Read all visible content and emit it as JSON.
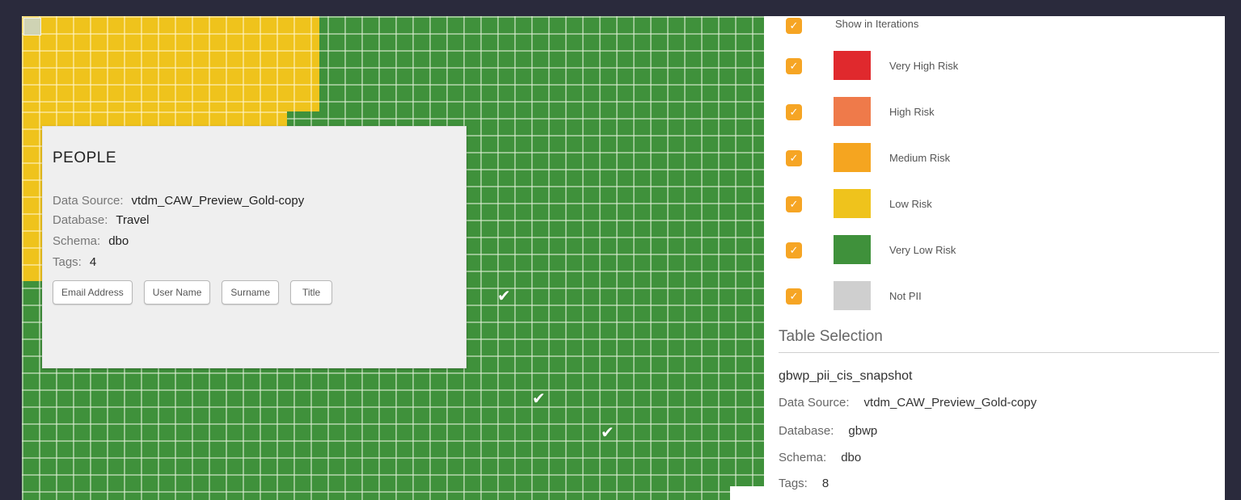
{
  "colors": {
    "very_high": "#e0292d",
    "high": "#ef7a4a",
    "medium": "#f5a520",
    "low": "#efc31c",
    "very_low": "#3f913b",
    "not_pii": "#cfcfcf",
    "checkbox": "#f6a524"
  },
  "popup": {
    "title": "PEOPLE",
    "data_source_label": "Data Source:",
    "data_source_value": "vtdm_CAW_Preview_Gold-copy",
    "database_label": "Database:",
    "database_value": "Travel",
    "schema_label": "Schema:",
    "schema_value": "dbo",
    "tags_label": "Tags:",
    "tags_count": "4",
    "tags": [
      "Email Address",
      "User Name",
      "Surname",
      "Title"
    ]
  },
  "legend": {
    "header": "Show in Iterations",
    "items": [
      {
        "label": "Very High Risk",
        "checked": true,
        "color": "#e0292d"
      },
      {
        "label": "High Risk",
        "checked": true,
        "color": "#ef7a4a"
      },
      {
        "label": "Medium Risk",
        "checked": true,
        "color": "#f5a520"
      },
      {
        "label": "Low Risk",
        "checked": true,
        "color": "#efc31c"
      },
      {
        "label": "Very Low Risk",
        "checked": true,
        "color": "#3f913b"
      },
      {
        "label": "Not PII",
        "checked": true,
        "color": "#cfcfcf"
      }
    ],
    "check_glyph": "✓"
  },
  "table_selection": {
    "title": "Table Selection",
    "name": "gbwp_pii_cis_snapshot",
    "data_source_label": "Data Source:",
    "data_source_value": "vtdm_CAW_Preview_Gold-copy",
    "database_label": "Database:",
    "database_value": "gbwp",
    "schema_label": "Schema:",
    "schema_value": "dbo",
    "tags_label": "Tags:",
    "tags_value": "8"
  },
  "map": {
    "check_glyph": "✔"
  }
}
